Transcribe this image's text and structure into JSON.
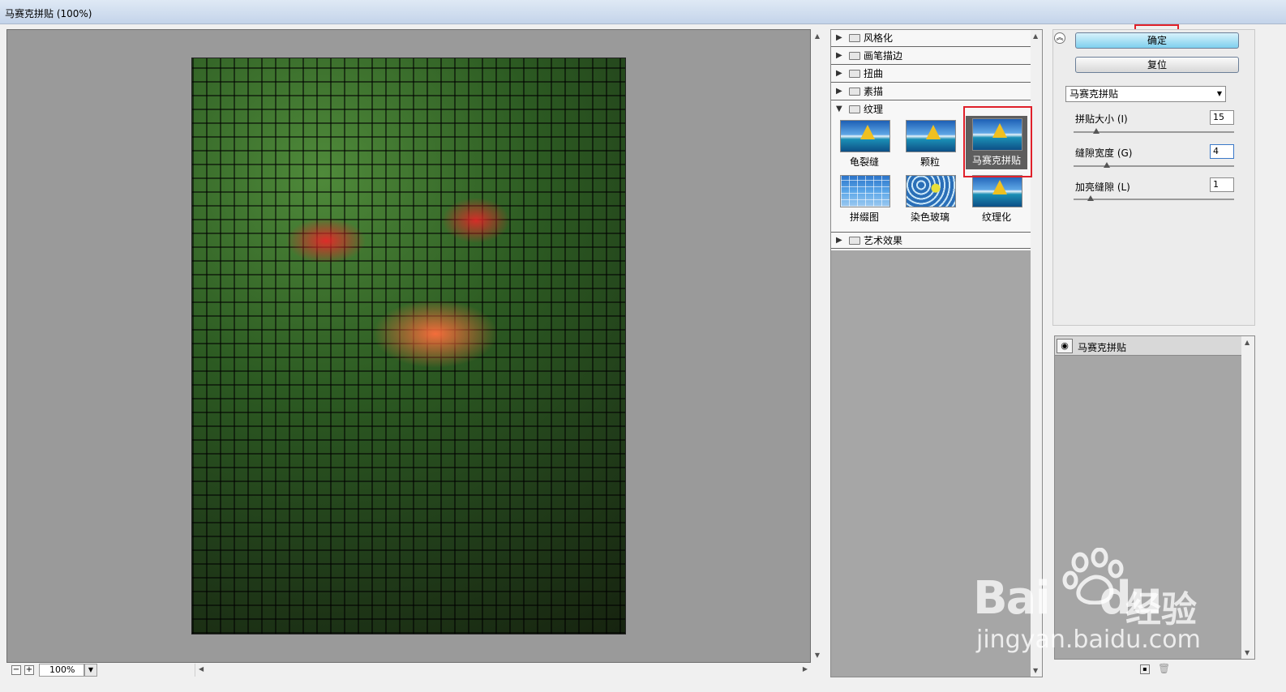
{
  "window": {
    "title": "马赛克拼贴 (100%)"
  },
  "preview": {
    "zoom": "100%",
    "zoom_out_symbol": "−",
    "zoom_in_symbol": "+"
  },
  "gallery": {
    "categories": [
      {
        "label": "风格化",
        "expanded": false
      },
      {
        "label": "画笔描边",
        "expanded": false
      },
      {
        "label": "扭曲",
        "expanded": false
      },
      {
        "label": "素描",
        "expanded": false
      },
      {
        "label": "纹理",
        "expanded": true
      },
      {
        "label": "艺术效果",
        "expanded": false
      }
    ],
    "texture_filters": [
      {
        "label": "龟裂缝",
        "icon": "sailboat-thumbnail"
      },
      {
        "label": "颗粒",
        "icon": "sailboat-thumbnail"
      },
      {
        "label": "马赛克拼贴",
        "icon": "sailboat-thumbnail",
        "selected": true
      },
      {
        "label": "拼缀图",
        "icon": "patchwork-thumbnail"
      },
      {
        "label": "染色玻璃",
        "icon": "stained-glass-thumbnail"
      },
      {
        "label": "纹理化",
        "icon": "sailboat-thumbnail"
      }
    ]
  },
  "settings": {
    "ok_label": "确定",
    "reset_label": "复位",
    "selected_filter": "马赛克拼贴",
    "params": [
      {
        "label": "拼贴大小 (I)",
        "value": "15",
        "slider_fraction": 0.1
      },
      {
        "label": "缝隙宽度 (G)",
        "value": "4",
        "slider_fraction": 0.2
      },
      {
        "label": "加亮缝隙 (L)",
        "value": "1",
        "slider_fraction": 0.1
      }
    ]
  },
  "layers": {
    "items": [
      {
        "label": "马赛克拼贴",
        "visible": true
      }
    ]
  },
  "watermark": {
    "brand": "Bai",
    "brand2": "du",
    "cn": "经验",
    "url": "jingyan.baidu.com"
  },
  "colors": {
    "highlight_box": "#e0202a",
    "ok_button": "#7fd0ee"
  }
}
